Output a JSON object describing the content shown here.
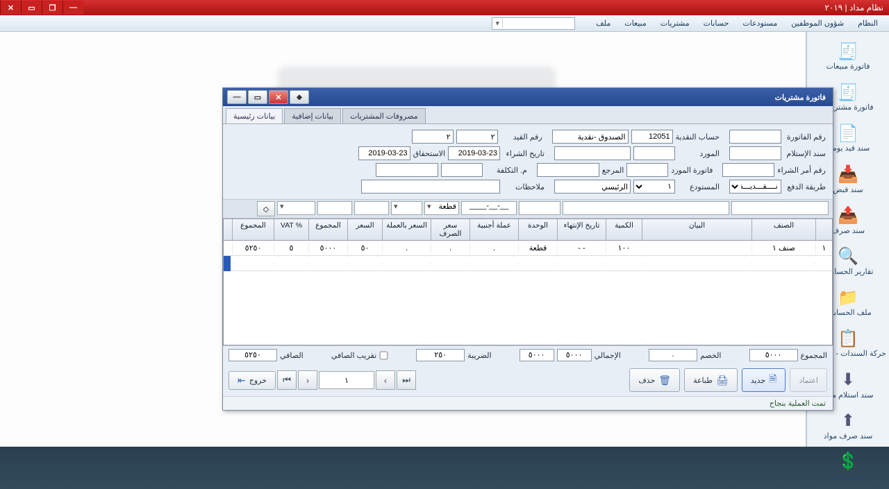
{
  "app_titlebar": {
    "title": "نظام مداد | ٢٠١٩"
  },
  "menubar": [
    "النظام",
    "شؤون الموظفين",
    "مستودعات",
    "حسابات",
    "مشتريات",
    "مبيعات",
    "ملف"
  ],
  "sidebar": [
    {
      "icon": "🧾",
      "label": "فاتورة مبيعات"
    },
    {
      "icon": "🧾",
      "label": "فاتورة مشتريات"
    },
    {
      "icon": "📄",
      "label": "سند قيد يومية"
    },
    {
      "icon": "📥",
      "label": "سند قبض"
    },
    {
      "icon": "📤",
      "label": "سند صرف"
    },
    {
      "icon": "🔍",
      "label": "تقارير الحسابات"
    },
    {
      "icon": "📁",
      "label": "ملف الحسابات"
    },
    {
      "icon": "📋",
      "label": "حركة السندات - تفصيلية"
    },
    {
      "icon": "⬇",
      "label": "سند استلام مواد"
    },
    {
      "icon": "⬆",
      "label": "سند صرف مواد"
    },
    {
      "icon": "💲",
      "label": "عرض سعر"
    }
  ],
  "window": {
    "title": "فاتورة مشتريات",
    "tabs": [
      "مصروفات المشتريات",
      "بيانات إضافية",
      "بيانات رئيسية"
    ],
    "active_tab": 2,
    "fields": {
      "invoice_no_lbl": "رقم الفاتورة",
      "invoice_no": "",
      "cash_account_lbl": "حساب النقدية",
      "cash_account_code": "12051",
      "cash_account_name": "الصندوق -نقدية",
      "entry_no_lbl": "رقم القيد",
      "entry_no1": "٢",
      "entry_no2": "٢",
      "receipt_doc_lbl": "سند الإستلام",
      "receipt_doc": "",
      "supplier_lbl": "المورد",
      "supplier": "",
      "purchase_date_lbl": "تاريخ الشراء",
      "purchase_date": "2019-03-23",
      "due_lbl": "الاستحقاق",
      "due_date": "2019-03-23",
      "po_lbl": "رقم أمر الشراء",
      "po": "",
      "supplier_inv_lbl": "فاتورة المورد",
      "supplier_inv": "",
      "ref_lbl": "المرجع",
      "ref": "",
      "cost_center_lbl": "م. التكلفة",
      "cost_center": "",
      "payment_lbl": "طريقة الدفع",
      "payment": "نــــقـــديـــة",
      "warehouse_lbl": "المستودع",
      "warehouse_code": "١",
      "warehouse_name": "الرئيسي",
      "notes_lbl": "ملاحظات",
      "notes": ""
    },
    "grid": {
      "headers": [
        "",
        "الصنف",
        "البيان",
        "الكمية",
        "تاريخ الإنتهاء",
        "الوحدة",
        "عملة أجنبية",
        "سعر الصرف",
        "السعر بالعملة",
        "السعر",
        "المجموع",
        "% VAT",
        "المجموع"
      ],
      "row": [
        "١",
        "صنف ١",
        "",
        "١٠٠",
        "- -",
        "قطعة",
        ".",
        ".",
        ".",
        "٥٠",
        "٥٠٠٠",
        "٥",
        "٥٢٥٠"
      ]
    },
    "subgrid_unit": "قطعة",
    "subgrid_date": "__-__-____",
    "totals": {
      "grand_lbl": "المجموع",
      "grand": "٥٠٠٠",
      "discount_lbl": "الخصم",
      "discount": ".",
      "subtotal_lbl": "الإجمالي",
      "subtotal": "٥٠٠٠",
      "subtotal2": "٥٠٠٠",
      "tax_lbl": "الضريبة",
      "tax": "٢٥٠",
      "round_lbl": "تقريب الصافي",
      "net_lbl": "الصافي",
      "net": "٥٢٥٠"
    },
    "footer": {
      "approve": "اعتماد",
      "new": "جديد",
      "print": "طباعة",
      "delete": "حذف",
      "exit": "خروج",
      "page": "١"
    },
    "status": "تمت العملية بنجاح"
  }
}
